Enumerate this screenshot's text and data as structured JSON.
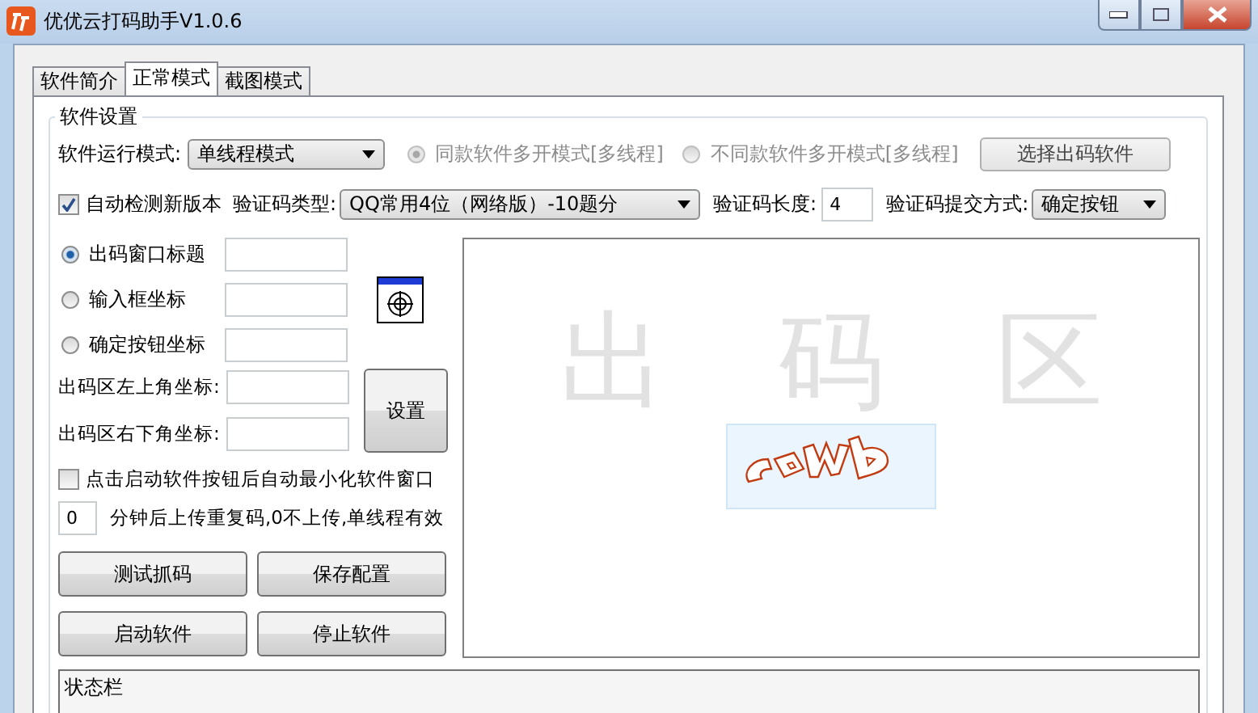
{
  "window": {
    "title": "优优云打码助手V1.0.6"
  },
  "tabs": [
    {
      "label": "软件简介",
      "selected": false
    },
    {
      "label": "正常模式",
      "selected": true
    },
    {
      "label": "截图模式",
      "selected": false
    }
  ],
  "group_title": "软件设置",
  "run_mode": {
    "label": "软件运行模式:",
    "value": "单线程模式",
    "radios": [
      {
        "label": "同款软件多开模式[多线程]",
        "selected": true,
        "disabled": true
      },
      {
        "label": "不同款软件多开模式[多线程]",
        "selected": false,
        "disabled": true
      }
    ],
    "button": "选择出码软件"
  },
  "auto_update": {
    "label": "自动检测新版本",
    "checked": true
  },
  "captcha_type": {
    "label": "验证码类型:",
    "value": "QQ常用4位（网络版）-10题分"
  },
  "captcha_length": {
    "label": "验证码长度:",
    "value": "4"
  },
  "submit_method": {
    "label": "验证码提交方式:",
    "value": "确定按钮"
  },
  "targets": [
    {
      "label": "出码窗口标题",
      "selected": true
    },
    {
      "label": "输入框坐标",
      "selected": false
    },
    {
      "label": "确定按钮坐标",
      "selected": false
    }
  ],
  "corners": [
    {
      "label": "出码区左上角坐标:"
    },
    {
      "label": "出码区右下角坐标:"
    }
  ],
  "set_button": "设置",
  "minimize": {
    "label": "点击启动软件按钮后自动最小化软件窗口",
    "checked": false
  },
  "upload": {
    "value": "0",
    "text": "分钟后上传重复码,0不上传,单线程有效"
  },
  "buttons": [
    "测试抓码",
    "保存配置",
    "启动软件",
    "停止软件"
  ],
  "captcha_area": {
    "watermark": [
      "出",
      "码",
      "区"
    ],
    "image": {
      "kind": "picture"
    }
  },
  "status_bar": "状态栏"
}
